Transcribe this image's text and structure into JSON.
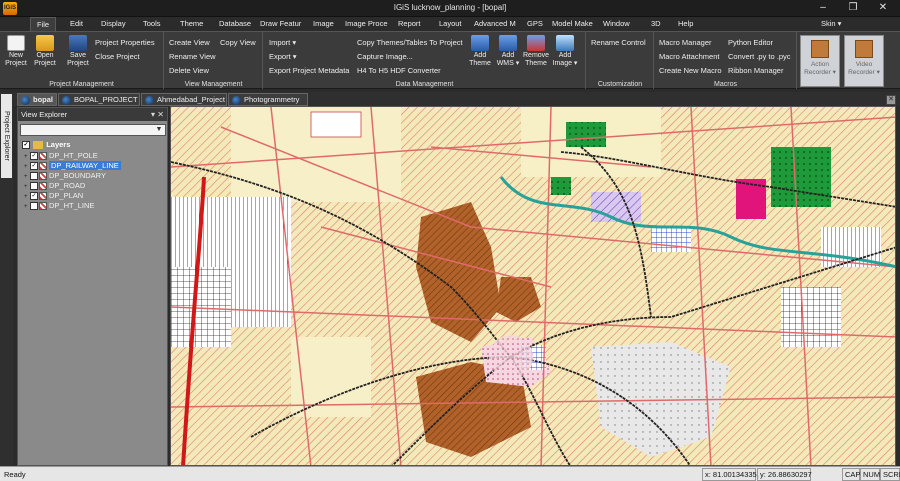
{
  "titlebar": {
    "app_logo": "IGiS",
    "title": "IGiS lucknow_planning - [bopal]",
    "controls": [
      "–",
      "❐",
      "✕"
    ]
  },
  "menu": [
    "File",
    "Edit",
    "Display",
    "Tools",
    "Theme",
    "Database",
    "Draw Featur",
    "Image",
    "Image Proce",
    "Report",
    "Layout",
    "Advanced M",
    "GPS",
    "Model Make",
    "Window",
    "3D",
    "Help"
  ],
  "skin_label": "Skin ▾",
  "ribbon": {
    "project_management": {
      "label": "Project Management",
      "new_project": "New Project",
      "open_project": "Open Project",
      "save_project": "Save Project",
      "project_properties": "Project Properties",
      "close_project": "Close Project"
    },
    "view_management": {
      "label": "View Management",
      "create_view": "Create View",
      "copy_view": "Copy View",
      "rename_view": "Rename View",
      "delete_view": "Delete View"
    },
    "data_management": {
      "label": "Data Management",
      "import": "Import ▾",
      "export": "Export ▾",
      "export_metadata": "Export Project Metadata",
      "copy_themes": "Copy Themes/Tables To Project",
      "capture_image": "Capture Image...",
      "h4_h5": "H4 To H5 HDF Converter",
      "add_theme": "Add Theme",
      "add_wms": "Add WMS ▾",
      "remove_theme": "Remove Theme",
      "add_image": "Add Image ▾"
    },
    "customization": {
      "label": "Customization",
      "rename_control": "Rename Control"
    },
    "macros": {
      "label": "Macros",
      "macro_manager": "Macro Manager",
      "macro_attachment": "Macro Attachment",
      "create_new_macro": "Create New Macro",
      "python_editor": "Python Editor",
      "convert_py": "Convert .py to .pyc",
      "ribbon_manager": "Ribbon Manager"
    },
    "action_recorder": "Action Recorder ▾",
    "video_recorder": "Video Recorder ▾"
  },
  "side_tab": "Project Explorer",
  "doc_tabs": [
    "bopal",
    "BOPAL_PROJECT",
    "Ahmedabad_Project",
    "Photogrammetry"
  ],
  "view_explorer": {
    "title": "View Explorer",
    "pin": "▾ ✕",
    "root_label": "Layers",
    "layers": [
      {
        "name": "DP_HT_POLE",
        "checked": "✓"
      },
      {
        "name": "DP_RAILWAY_LINE",
        "checked": "✓"
      },
      {
        "name": "DP_BOUNDARY",
        "checked": ""
      },
      {
        "name": "DP_ROAD",
        "checked": ""
      },
      {
        "name": "DP_PLAN",
        "checked": "✓"
      },
      {
        "name": "DP_HT_LINE",
        "checked": ""
      }
    ]
  },
  "status": {
    "ready": "Ready",
    "x": "x: 81.00134335,",
    "y": "y: 26.88630297",
    "cap": "CAP",
    "num": "NUM",
    "scrl": "SCRL"
  },
  "colors": {
    "map_base": "#f4eab8",
    "road": "#e06a6a",
    "railway": "#222222",
    "water": "#2aa198",
    "dense_area": "#b0622a",
    "selection": "#3a7bd5"
  }
}
